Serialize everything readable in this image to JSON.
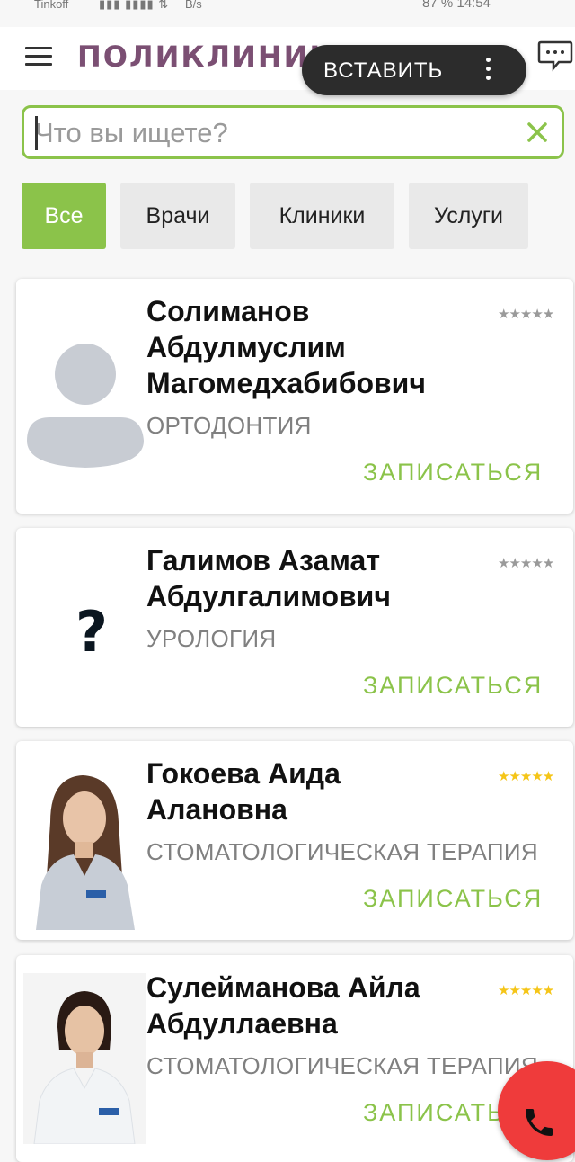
{
  "status_bar": {
    "carrier": "Tinkoff",
    "speed": "B/s",
    "right_text": "87 % 14:54"
  },
  "header": {
    "logo_text": "ПОЛИКЛИНИКА.РУ",
    "menu_icon": "hamburger-icon",
    "chat_icon": "chat-bubble-icon"
  },
  "paste_popup": {
    "label": "ВСТАВИТЬ",
    "more_icon": "more-vertical-icon"
  },
  "search": {
    "placeholder": "Что вы ищете?",
    "value": "",
    "clear_icon": "close-icon"
  },
  "filters": [
    {
      "label": "Все",
      "active": true
    },
    {
      "label": "Врачи",
      "active": false
    },
    {
      "label": "Клиники",
      "active": false
    },
    {
      "label": "Услуги",
      "active": false
    }
  ],
  "doctors": [
    {
      "name_lines": [
        "Солиманов",
        "Абдулмуслим",
        "Магомедхабибович"
      ],
      "specialty": "ОРТОДОНТИЯ",
      "rating": 0,
      "avatar": "default-user-icon",
      "action": "ЗАПИСАТЬСЯ"
    },
    {
      "name_lines": [
        "Галимов Азамат",
        "Абдулгалимович"
      ],
      "specialty": "УРОЛОГИЯ",
      "rating": 0,
      "avatar": "question-mark-icon",
      "action": "ЗАПИСАТЬСЯ"
    },
    {
      "name_lines": [
        "Гокоева Аида",
        "Алановна"
      ],
      "specialty": "СТОМАТОЛОГИЧЕСКАЯ ТЕРАПИЯ",
      "rating": 5,
      "avatar": "doctor-photo",
      "action": "ЗАПИСАТЬСЯ"
    },
    {
      "name_lines": [
        "Сулейманова Айла",
        "Абдуллаевна"
      ],
      "specialty": "СТОМАТОЛОГИЧЕСКАЯ ТЕРАПИЯ",
      "rating": 5,
      "avatar": "doctor-photo",
      "action": "ЗАПИСАТЬСЯ"
    }
  ],
  "stars_text": "★★★★★",
  "fab": {
    "icon": "phone-icon"
  },
  "colors": {
    "accent": "#8bc34a",
    "logo": "#7b4f73",
    "star_gold": "#f5c518",
    "star_gray": "#9a9a9a",
    "fab": "#ef3b3b"
  }
}
